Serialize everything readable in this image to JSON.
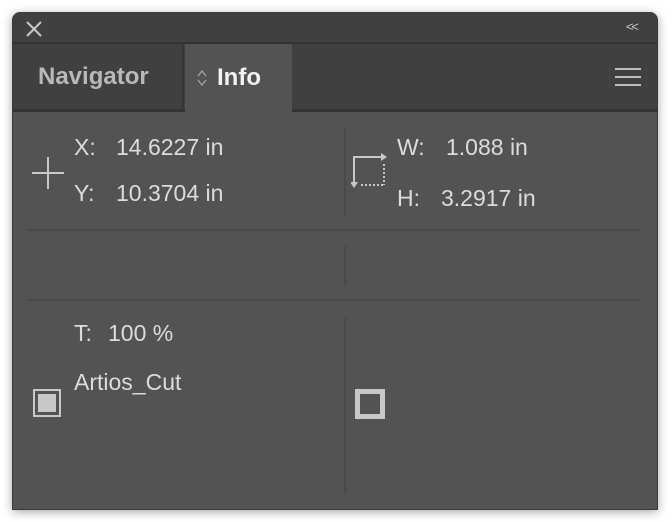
{
  "window": {
    "close_icon": "close-icon",
    "collapse_label": "<<"
  },
  "tabs": [
    {
      "label": "Navigator",
      "active": false
    },
    {
      "label": "Info",
      "active": true,
      "icon": "up-down-arrows-icon"
    }
  ],
  "panel_menu_icon": "hamburger-menu-icon",
  "position": {
    "icon": "crosshair-icon",
    "x_label": "X:",
    "x_value": "14.6227 in",
    "y_label": "Y:",
    "y_value": "10.3704 in"
  },
  "size": {
    "icon": "dimensions-icon",
    "w_label": "W:",
    "w_value": "1.088 in",
    "h_label": "H:",
    "h_value": "3.2917 in"
  },
  "appearance": {
    "tint_label": "T:",
    "tint_value": "100 %",
    "swatch_name": "Artios_Cut",
    "fill_icon": "fill-swatch-icon",
    "stroke_icon": "stroke-swatch-icon"
  }
}
